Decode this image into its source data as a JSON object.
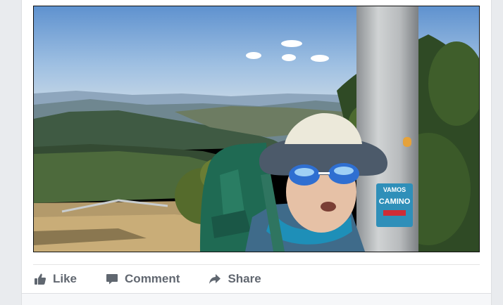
{
  "post": {
    "video": {
      "description": "",
      "sign_text": [
        "VAMOS",
        "CAMINO"
      ]
    },
    "actions": [
      {
        "label": "Like",
        "icon": "thumbs-up-icon"
      },
      {
        "label": "Comment",
        "icon": "comment-icon"
      },
      {
        "label": "Share",
        "icon": "share-arrow-icon"
      }
    ]
  },
  "colors": {
    "page_bg": "#e9ebee",
    "card_bg": "#ffffff",
    "action_text": "#616770"
  }
}
